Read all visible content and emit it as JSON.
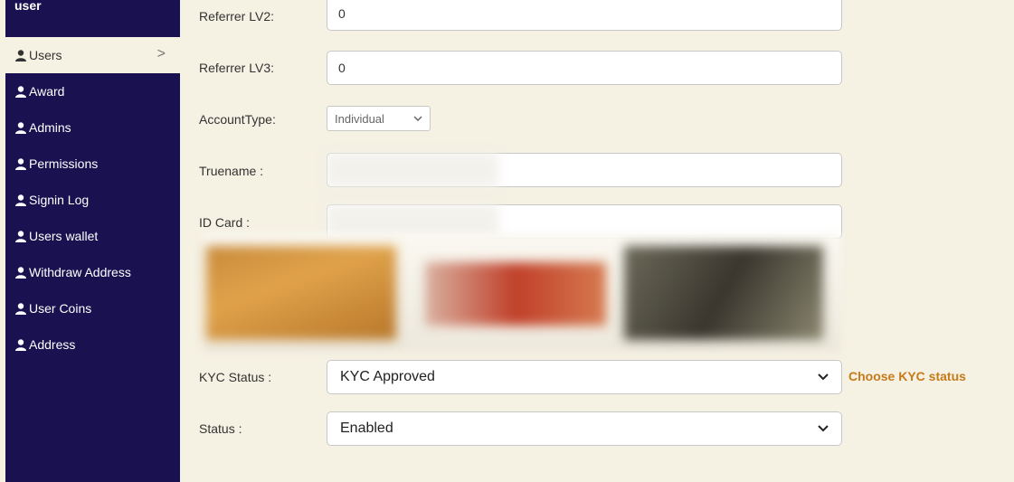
{
  "sidebar": {
    "title": "user",
    "items": [
      {
        "label": "Users"
      },
      {
        "label": "Award"
      },
      {
        "label": "Admins"
      },
      {
        "label": "Permissions"
      },
      {
        "label": "Signin Log"
      },
      {
        "label": "Users wallet"
      },
      {
        "label": "Withdraw Address"
      },
      {
        "label": "User Coins"
      },
      {
        "label": "Address"
      }
    ],
    "active_chevron": ">"
  },
  "form": {
    "referrer_lv2": {
      "label": "Referrer LV2:",
      "value": "0"
    },
    "referrer_lv3": {
      "label": "Referrer LV3:",
      "value": "0"
    },
    "account_type": {
      "label": "AccountType:",
      "value": "Individual"
    },
    "truename": {
      "label": "Truename :"
    },
    "id_card": {
      "label": "ID Card :"
    },
    "kyc_status": {
      "label": "KYC Status :",
      "value": "KYC Approved",
      "hint": "Choose KYC status"
    },
    "status": {
      "label": "Status :",
      "value": "Enabled"
    }
  },
  "colors": {
    "sidebar_bg": "#1a1150",
    "page_bg": "#f5f1e3",
    "hint": "#c77a1a"
  },
  "icons": {
    "sidebar_item": "user-icon",
    "dropdown": "chevron-down-icon"
  }
}
